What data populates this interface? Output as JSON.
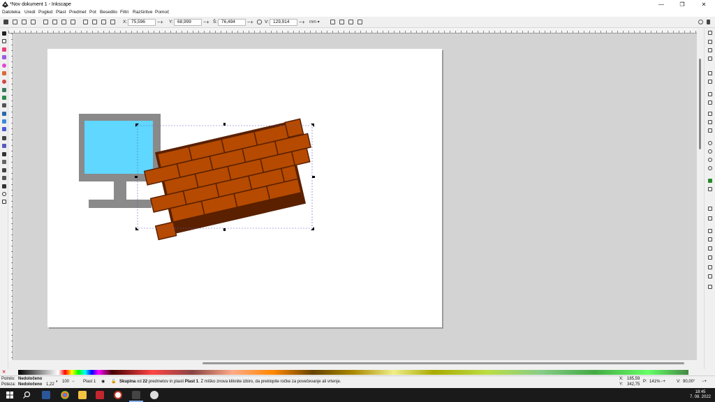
{
  "window": {
    "title": "*Nov dokument 1 - Inkscape"
  },
  "menu": [
    "Datoteka",
    "Uredi",
    "Pogled",
    "Plast",
    "Predmet",
    "Pot",
    "Besedilo",
    "Filtri",
    "Razširitve",
    "Pomoč"
  ],
  "toolbar": {
    "x_label": "X:",
    "x_value": "75,596",
    "y_label": "Y:",
    "y_value": "68,999",
    "w_label": "Š:",
    "w_value": "76,494",
    "h_label": "V:",
    "h_value": "129,914",
    "unit": "mm"
  },
  "colors": {
    "canvas_bg": "#d3d3d3",
    "monitor_frame": "#8a8a8a",
    "monitor_screen": "#5fd7ff",
    "brick": "#b54a00",
    "mortar": "#5a2000"
  },
  "status": {
    "fill_label": "Polnilo:",
    "fill_value": "Nedoločeno",
    "stroke_label": "Poteza:",
    "stroke_value": "Nedoločeno",
    "stroke_width": "1,22",
    "opacity": "100",
    "layer": "Plast 1",
    "msg_bold1": "Skupina",
    "msg_mid1": "od",
    "msg_count": "22",
    "msg_mid2": "predmetov in plasti",
    "msg_bold2": "Plast 1",
    "msg_rest": ". Z miško znova kliknite izbiro, da preklopite ročke za povečevanje ali vrtenje.",
    "cursor_x_label": "X:",
    "cursor_x": "185,59",
    "cursor_y_label": "Y:",
    "cursor_y": "342,75",
    "zoom_label": "P:",
    "zoom": "141%",
    "rotation_label": "V:",
    "rotation": "90,00°"
  },
  "clock": {
    "time": "18:45",
    "date": "7. 08. 2022"
  }
}
